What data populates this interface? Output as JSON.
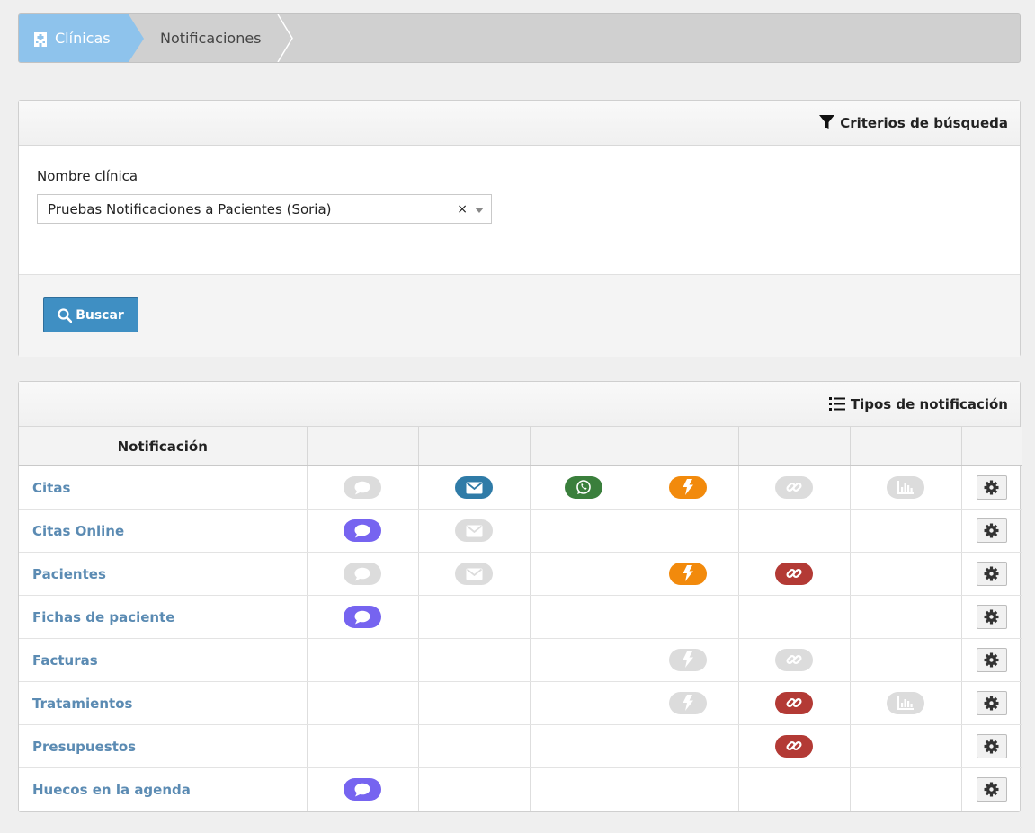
{
  "breadcrumb": {
    "home_label": "Clínicas",
    "current_label": "Notificaciones"
  },
  "search_panel": {
    "title": "Criterios de búsqueda",
    "field_label": "Nombre clínica",
    "selected_value": "Pruebas Notificaciones a Pacientes (Soria)",
    "clear_symbol": "×",
    "search_button": "Buscar"
  },
  "types_panel": {
    "title": "Tipos de notificación",
    "column_header": "Notificación"
  },
  "colors": {
    "inactive": "#dcdcdc",
    "sms_active": "#7664f0",
    "email_active": "#2f7ba7",
    "whatsapp_active": "#3a7f3c",
    "push_active": "#f28a0c",
    "link_active": "#b33a35"
  },
  "channels": [
    "sms-icon",
    "email-icon",
    "whatsapp-icon",
    "push-icon",
    "link-icon",
    "stats-icon"
  ],
  "rows": [
    {
      "label": "Citas",
      "cells": [
        "inactive",
        "active",
        "active",
        "active",
        "inactive",
        "inactive"
      ]
    },
    {
      "label": "Citas Online",
      "cells": [
        "active",
        "inactive",
        "",
        "",
        "",
        ""
      ]
    },
    {
      "label": "Pacientes",
      "cells": [
        "inactive",
        "inactive",
        "",
        "active",
        "active",
        ""
      ]
    },
    {
      "label": "Fichas de paciente",
      "cells": [
        "active",
        "",
        "",
        "",
        "",
        ""
      ]
    },
    {
      "label": "Facturas",
      "cells": [
        "",
        "",
        "",
        "inactive",
        "inactive",
        ""
      ]
    },
    {
      "label": "Tratamientos",
      "cells": [
        "",
        "",
        "",
        "inactive",
        "active",
        "inactive"
      ]
    },
    {
      "label": "Presupuestos",
      "cells": [
        "",
        "",
        "",
        "",
        "active",
        ""
      ]
    },
    {
      "label": "Huecos en la agenda",
      "cells": [
        "active",
        "",
        "",
        "",
        "",
        ""
      ]
    }
  ]
}
